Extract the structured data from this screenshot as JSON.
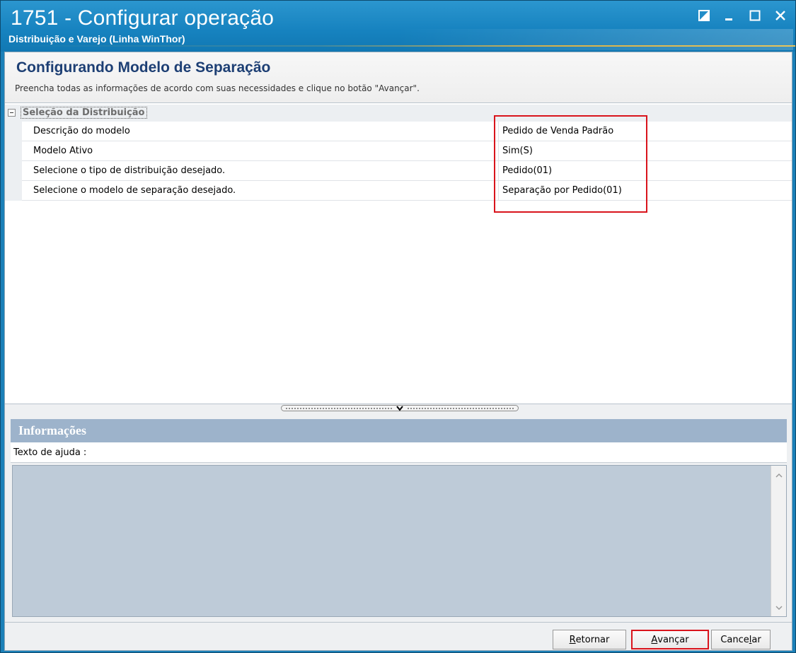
{
  "window": {
    "title": "1751 - Configurar operação",
    "subtitle": "Distribuição e Varejo (Linha WinThor)"
  },
  "header": {
    "title": "Configurando Modelo de Separação",
    "description": "Preencha todas as informações de acordo com suas necessidades e clique no botão \"Avançar\"."
  },
  "grid": {
    "category": "Seleção da Distribuição",
    "rows": [
      {
        "name": "Descrição do modelo",
        "value": "Pedido de Venda Padrão"
      },
      {
        "name": "Modelo Ativo",
        "value": "Sim(S)"
      },
      {
        "name": "Selecione o tipo de distribuição desejado.",
        "value": "Pedido(01)"
      },
      {
        "name": "Selecione o modelo de separação desejado.",
        "value": "Separação por Pedido(01)"
      }
    ]
  },
  "info": {
    "title": "Informações",
    "help_label": "Texto de ajuda :",
    "help_text": ""
  },
  "buttons": {
    "back": {
      "prefix": "",
      "accel": "R",
      "rest": "etornar"
    },
    "next": {
      "prefix": "",
      "accel": "A",
      "rest": "vançar"
    },
    "cancel": {
      "prefix": "Cance",
      "accel": "l",
      "rest": "ar"
    }
  },
  "colors": {
    "titlebar": "#1682bf",
    "header_title": "#1d3f74",
    "highlight": "#d9141c",
    "info_header": "#9db3cb",
    "help_bg": "#becbd8"
  }
}
